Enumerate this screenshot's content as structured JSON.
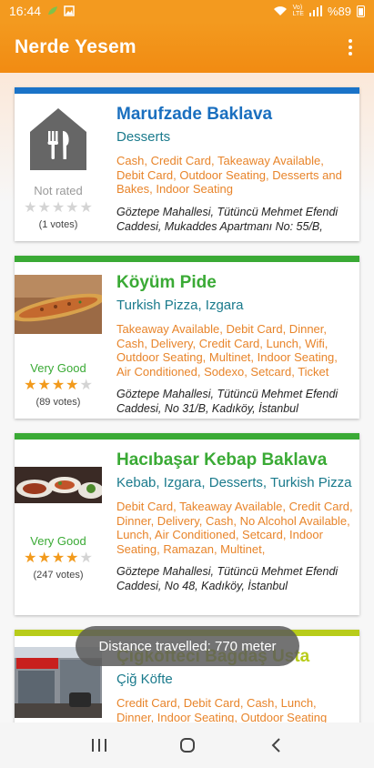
{
  "status": {
    "time": "16:44",
    "battery": "%89",
    "network_top": "Vo)",
    "network_bottom": "LTE"
  },
  "app": {
    "title": "Nerde Yesem"
  },
  "toast": "Distance travelled: 770 meter",
  "restaurants": [
    {
      "name": "Marufzade Baklava",
      "category": "Desserts",
      "tags": "Cash, Credit Card, Takeaway Available, Debit Card, Outdoor Seating, Desserts and Bakes, Indoor Seating",
      "address": "Göztepe Mahallesi, Tütüncü Mehmet Efendi Caddesi, Mukaddes Apartmanı No: 55/B,",
      "rating_label": "Not rated",
      "votes": "(1 votes)",
      "stars": 0,
      "accent": "#1a73c8",
      "image": "placeholder-store-icon"
    },
    {
      "name": "Köyüm Pide",
      "category": "Turkish Pizza, Izgara",
      "tags": "Takeaway Available, Debit Card, Dinner, Cash, Delivery, Credit Card, Lunch, Wifi, Outdoor Seating, Multinet, Indoor Seating, Air Conditioned, Sodexo, Setcard, Ticket",
      "address": "Göztepe Mahallesi, Tütüncü Mehmet Efendi Caddesi, No 31/B, Kadıköy, İstanbul",
      "rating_label": "Very Good",
      "votes": "(89 votes)",
      "stars": 4,
      "accent": "#3aaa35",
      "image": "pide-photo"
    },
    {
      "name": "Hacıbaşar Kebap Baklava",
      "category": "Kebab, Izgara, Desserts, Turkish Pizza",
      "tags": "Debit Card, Takeaway Available, Credit Card, Dinner, Delivery, Cash, No Alcohol Available, Lunch, Air Conditioned, Setcard, Indoor Seating, Ramazan, Multinet,",
      "address": "Göztepe Mahallesi, Tütüncü Mehmet Efendi Caddesi, No 48, Kadıköy, İstanbul",
      "rating_label": "Very Good",
      "votes": "(247 votes)",
      "stars": 4,
      "accent": "#3aaa35",
      "image": "kebab-photo"
    },
    {
      "name": "Çiğköfteci Bağdaş Usta",
      "category": "Çiğ Köfte",
      "tags": "Credit Card, Debit Card, Cash, Lunch, Dinner, Indoor Seating, Outdoor Seating",
      "address": "",
      "rating_label": "",
      "votes": "",
      "stars": 0,
      "accent": "#b8cc1a",
      "image": "shop-photo"
    }
  ],
  "colors": {
    "appbar": "#f39a1f",
    "name_blue": "#1a6fbf",
    "name_green": "#3aaa35",
    "category": "#1a7a8c",
    "tags": "#e8842a",
    "star": "#f29a1c"
  }
}
